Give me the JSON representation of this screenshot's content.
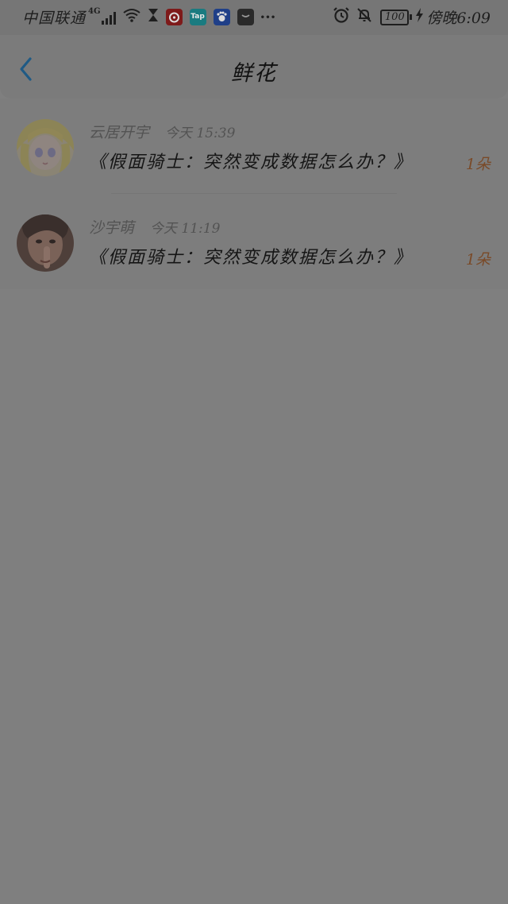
{
  "status_bar": {
    "carrier": "中国联通",
    "network": "4G",
    "app_badges": [
      {
        "name": "netease-music",
        "label": "",
        "color": "#7e1a1a"
      },
      {
        "name": "taptap",
        "label": "Tap",
        "color": "#1a7b80"
      },
      {
        "name": "baidu",
        "label": "",
        "color": "#1f3f88"
      },
      {
        "name": "bag-app",
        "label": "",
        "color": "#2a2a2a"
      }
    ],
    "more": "···",
    "battery": "100",
    "time": "傍晚6:09"
  },
  "nav": {
    "title": "鲜花"
  },
  "colors": {
    "overlay_bg": "#7f7f7f",
    "back_arrow": "#1f5a85",
    "count_text": "#7a4a28"
  },
  "entries": [
    {
      "user": "云居开宇",
      "time": "今天 15:39",
      "book": "《假面骑士：突然变成数据怎么办？》",
      "count": "1朵"
    },
    {
      "user": "沙宇萌",
      "time": "今天 11:19",
      "book": "《假面骑士：突然变成数据怎么办？》",
      "count": "1朵"
    }
  ]
}
